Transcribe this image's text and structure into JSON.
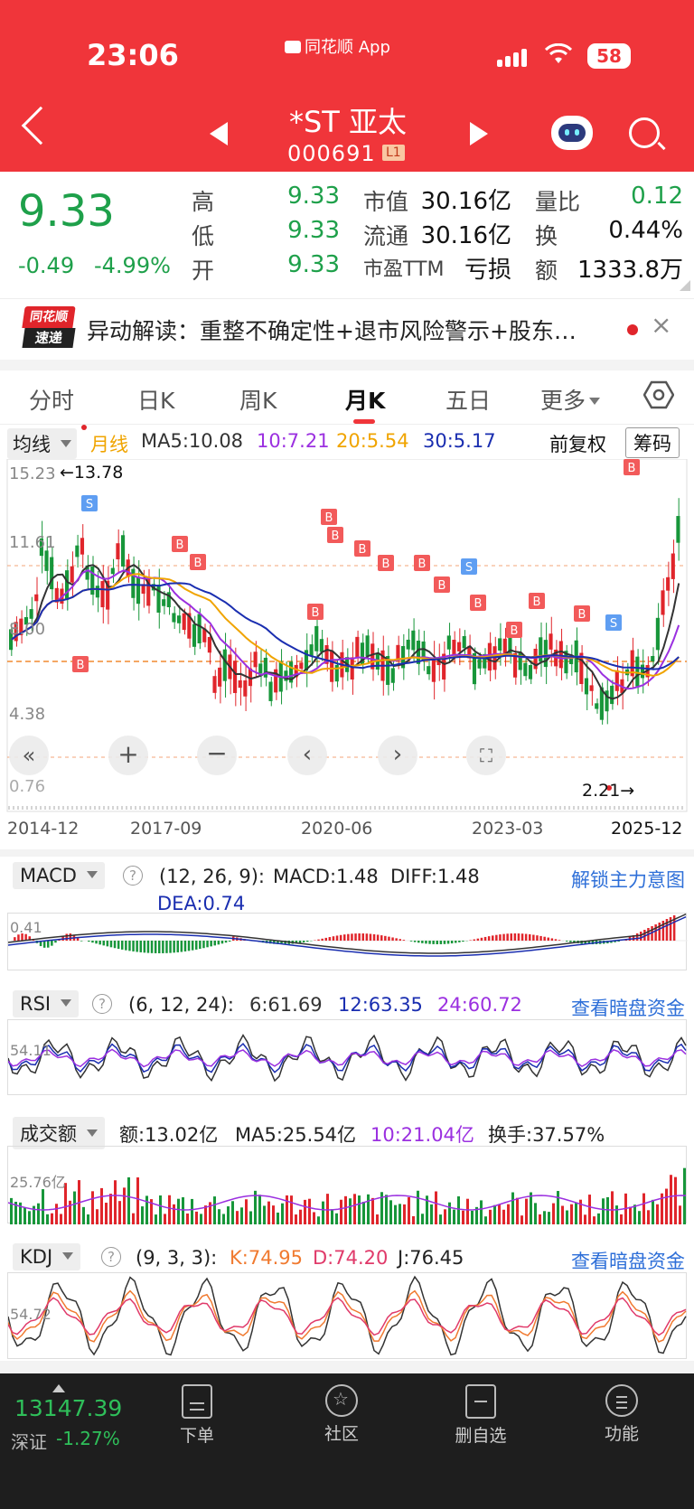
{
  "status": {
    "time": "23:06",
    "app": "同花顺 App",
    "battery": "58"
  },
  "header": {
    "name": "*ST 亚太",
    "code": "000691",
    "level": "L1"
  },
  "quote": {
    "price": "9.33",
    "change": "-0.49",
    "change_pct": "-4.99%",
    "labels": {
      "high": "高",
      "low": "低",
      "open": "开",
      "mcap": "市值",
      "float": "流通",
      "pe": "市盈TTM",
      "vr": "量比",
      "turnover": "换",
      "amount": "额"
    },
    "values": {
      "high": "9.33",
      "low": "9.33",
      "open": "9.33",
      "mcap": "30.16亿",
      "float": "30.16亿",
      "pe": "亏损",
      "vr": "0.12",
      "turnover": "0.44%",
      "amount": "1333.8万"
    }
  },
  "news": {
    "logo_top": "同花顺",
    "logo_bottom": "速递",
    "text": "异动解读：重整不确定性+退市风险警示+股东…",
    "close": "×"
  },
  "tabs": [
    {
      "label": "分时"
    },
    {
      "label": "日K"
    },
    {
      "label": "周K"
    },
    {
      "label": "月K"
    },
    {
      "label": "五日"
    },
    {
      "label": "更多"
    }
  ],
  "ma_bar": {
    "select": "均线",
    "type": "月线",
    "ma5": "MA5:10.08",
    "ma10": "10:7.21",
    "ma20": "20:5.54",
    "ma30": "30:5.17",
    "adjust": "前复权",
    "chips": "筹码"
  },
  "kchart": {
    "y_labels": [
      "15.23",
      "11.61",
      "8.00",
      "4.38",
      "0.76"
    ],
    "high_note": "←13.78",
    "low_note": "2.21→",
    "x_labels": [
      "2014-12",
      "2017-09",
      "2020-06",
      "2023-03",
      "2025-12"
    ],
    "colors": {
      "up": "#e0252b",
      "down": "#17963a",
      "ma5": "#333333",
      "ma10": "#9b30e0",
      "ma20": "#f0a400",
      "ma30": "#1a2eb0"
    }
  },
  "macd": {
    "select": "MACD",
    "params": "(12, 26, 9):",
    "macd": "MACD:1.48",
    "diff": "DIFF:1.48",
    "dea": "DEA:0.74",
    "link": "解锁主力意图",
    "axis": "0.41"
  },
  "rsi": {
    "select": "RSI",
    "params": "(6, 12, 24):",
    "r6": "6:61.69",
    "r12": "12:63.35",
    "r24": "24:60.72",
    "link": "查看暗盘资金",
    "axis": "54.11"
  },
  "volume": {
    "select": "成交额",
    "amount": "额:13.02亿",
    "ma5": "MA5:25.54亿",
    "ma10": "10:21.04亿",
    "turnover": "换手:37.57%",
    "axis": "25.76亿"
  },
  "kdj": {
    "select": "KDJ",
    "params": "(9, 3, 3):",
    "k": "K:74.95",
    "d": "D:74.20",
    "j": "J:76.45",
    "link": "查看暗盘资金",
    "axis": "54.72"
  },
  "bottom": {
    "index_value": "13147.39",
    "index_name": "深证",
    "index_change": "-1.27%",
    "nav": [
      {
        "label": "下单"
      },
      {
        "label": "社区"
      },
      {
        "label": "删自选"
      },
      {
        "label": "功能"
      }
    ]
  }
}
